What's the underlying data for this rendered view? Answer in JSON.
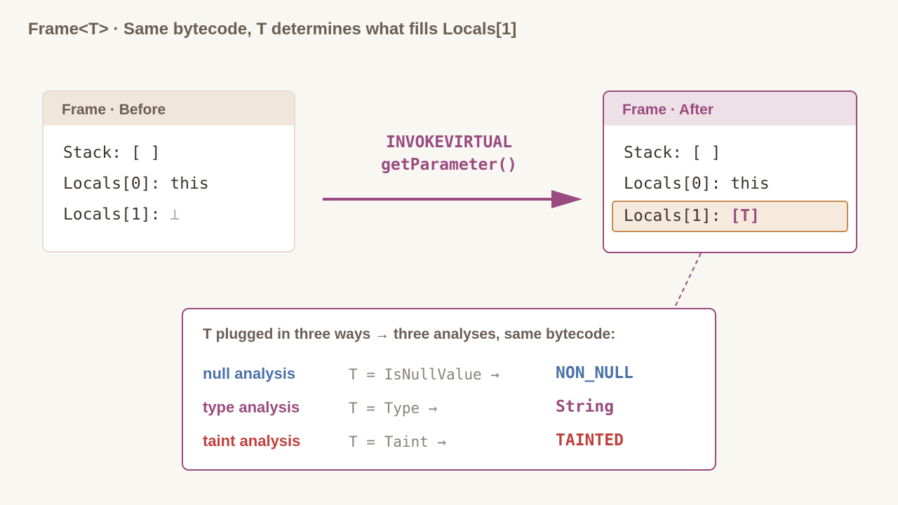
{
  "title": "Frame<T> · Same bytecode, T determines what fills Locals[1]",
  "before": {
    "header": "Frame · Before",
    "stack_label": "Stack: ",
    "stack_value": "[ ]",
    "locals0_label": "Locals[0]: ",
    "locals0_value": "this",
    "locals1_label": "Locals[1]: ",
    "locals1_value": "⊥"
  },
  "after": {
    "header": "Frame · After",
    "stack_label": "Stack: ",
    "stack_value": "[ ]",
    "locals0_label": "Locals[0]: ",
    "locals0_value": "this",
    "locals1_label": "Locals[1]: ",
    "locals1_value": "[T]"
  },
  "operation": {
    "line1": "INVOKEVIRTUAL",
    "line2": "getParameter()"
  },
  "analyses": {
    "title": "T plugged in three ways → three analyses, same bytecode:",
    "rows": [
      {
        "name": "null analysis",
        "expr": "T = IsNullValue →",
        "result": "NON_NULL"
      },
      {
        "name": "type analysis",
        "expr": "T = Type →",
        "result": "String"
      },
      {
        "name": "taint analysis",
        "expr": "T = Taint →",
        "result": "TAINTED"
      }
    ]
  },
  "colors": {
    "accent": "#9a4a80",
    "null": "#4a72a8",
    "taint": "#c0403c",
    "highlight_border": "#c98d52",
    "highlight_fill": "#f6eadc",
    "text": "#6b5d55",
    "background": "#f9f7f2"
  }
}
